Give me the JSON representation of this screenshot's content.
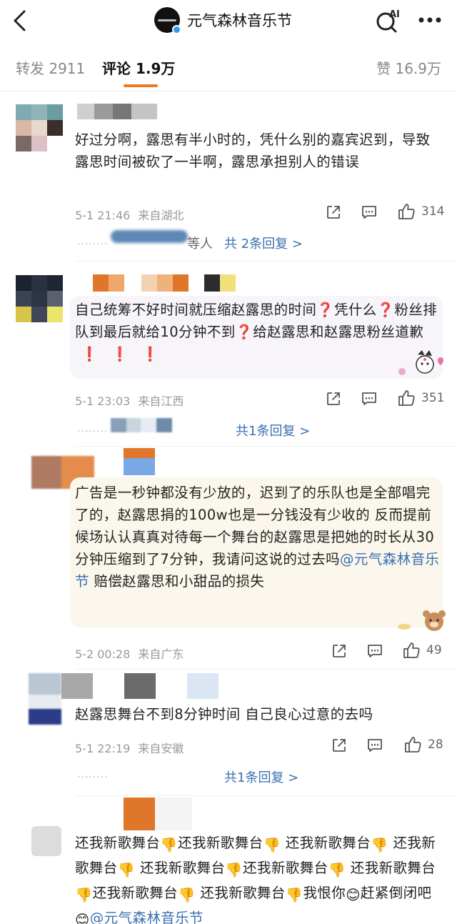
{
  "header": {
    "account_name": "元气森林音乐节",
    "back_icon": "chevron-left-icon",
    "ai_label": "AI",
    "more_icon": "more-dots-icon"
  },
  "tabs": {
    "repost": "转发 2911",
    "comment": "评论 1.9万",
    "like": "赞 16.9万"
  },
  "colors": {
    "accent": "#f07a1e",
    "link": "#3a6fb0",
    "meta": "#999999"
  },
  "comments": [
    {
      "text": "好过分啊，露思有半小时的，凭什么别的嘉宾迟到，导致露思时间被砍了一半啊，露思承担别人的错误",
      "time": "5-1 21:46",
      "location": "来自湖北",
      "likes": "314",
      "reply_who": "等人",
      "reply_label": "共 2条回复 >"
    },
    {
      "text_parts": [
        "自己统筹不好时间就压缩赵露思的时间",
        "❓",
        "凭什么",
        "❓",
        "粉丝排队到最后就给10分钟不到",
        "❓",
        "给赵露思和赵露思粉丝道歉",
        "❗ ❗ ❗"
      ],
      "time": "5-1 23:03",
      "location": "来自江西",
      "likes": "351",
      "reply_label": "共1条回复 >"
    },
    {
      "text": "广告是一秒钟都没有少放的，迟到了的乐队也是全部唱完了的，赵露思捐的100w也是一分钱没有少收的 反而提前候场认认真真对待每一个舞台的赵露思是把她的时长从30分钟压缩到了7分钟，我请问这说的过去吗",
      "mention": "@元气森林音乐节",
      "text_tail": " 赔偿赵露思和小甜品的损失",
      "time": "5-2 00:28",
      "location": "来自广东",
      "likes": "49"
    },
    {
      "text": "赵露思舞台不到8分钟时间 自己良心过意的去吗",
      "time": "5-1 22:19",
      "location": "来自安徽",
      "likes": "28",
      "reply_label": "共1条回复 >"
    },
    {
      "line1": "还我新歌舞台",
      "repeat_unit": "还我新歌舞台",
      "tail1": "我恨你",
      "tail2": "赶紧倒闭吧",
      "mention": "@元气森林音乐节"
    }
  ]
}
